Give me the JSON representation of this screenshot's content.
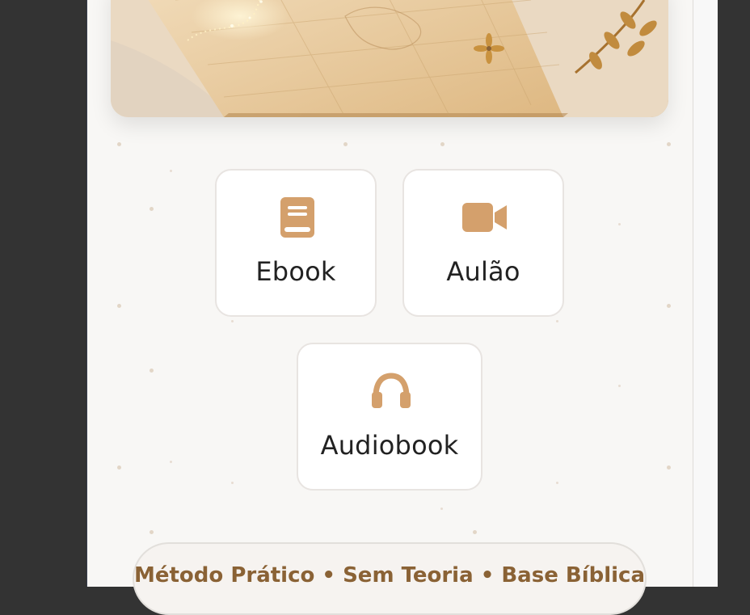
{
  "colors": {
    "frame": "#333333",
    "panel_bg": "#f8f7f5",
    "accent": "#d4a06c",
    "pill_text": "#8a6235",
    "card_border": "#e8e4e1"
  },
  "hero": {
    "image_icon": "open-bible-with-sparkles-image"
  },
  "options": [
    {
      "label": "Ebook",
      "icon": "book-icon"
    },
    {
      "label": "Aulão",
      "icon": "video-camera-icon"
    },
    {
      "label": "Audiobook",
      "icon": "headphones-icon"
    }
  ],
  "footer_pill": {
    "text": "Método Prático • Sem Teoria • Base Bíblica"
  }
}
